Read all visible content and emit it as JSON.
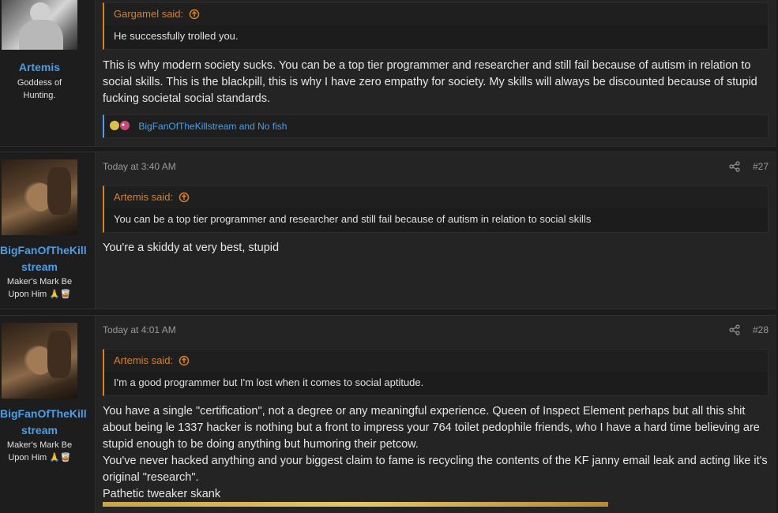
{
  "posts": [
    {
      "user": {
        "name": "Artemis",
        "title": "Goddess of Hunting."
      },
      "quote": {
        "author": "Gargamel said:",
        "text": "He successfully trolled you."
      },
      "message": [
        "This is why modern society sucks. You can be a top tier programmer and researcher and still fail because of autism in relation to social skills. This is the blackpill, this is why I have zero empathy for society. My skills will always be discounted because of stupid fucking societal social standards."
      ],
      "reactions": "BigFanOfTheKillstream and No fish"
    },
    {
      "user": {
        "name_line1": "BigFanOfTheKill",
        "name_line2": "stream",
        "title_line1": "Maker's Mark Be",
        "title_line2": "Upon Him 🙏🥃"
      },
      "time": "Today at 3:40 AM",
      "number": "#27",
      "quote": {
        "author": "Artemis said:",
        "text": "You can be a top tier programmer and researcher and still fail because of autism in relation to social skills"
      },
      "message": [
        "You're a skiddy at very best, stupid"
      ]
    },
    {
      "user": {
        "name_line1": "BigFanOfTheKill",
        "name_line2": "stream",
        "title_line1": "Maker's Mark Be",
        "title_line2": "Upon Him 🙏🥃"
      },
      "time": "Today at 4:01 AM",
      "number": "#28",
      "quote": {
        "author": "Artemis said:",
        "text": "I'm a good programmer but I'm lost when it comes to social aptitude."
      },
      "message": [
        "You have a single \"certification\", not a degree or any meaningful experience. Queen of Inspect Element perhaps but all this shit about being le 1337 hacker is nothing but a front to impress your 764 toilet pedophile friends, who I have a hard time believing are stupid enough to be doing anything but humoring their petcow.",
        "You've never hacked anything and your biggest claim to fame is recycling the contents of the KF janny email leak and acting like it's original \"research\".",
        "Pathetic tweaker skank"
      ]
    }
  ],
  "colors": {
    "accent_quote": "#d98025",
    "accent_link": "#4c9ee8",
    "background": "#1b1b1b"
  }
}
